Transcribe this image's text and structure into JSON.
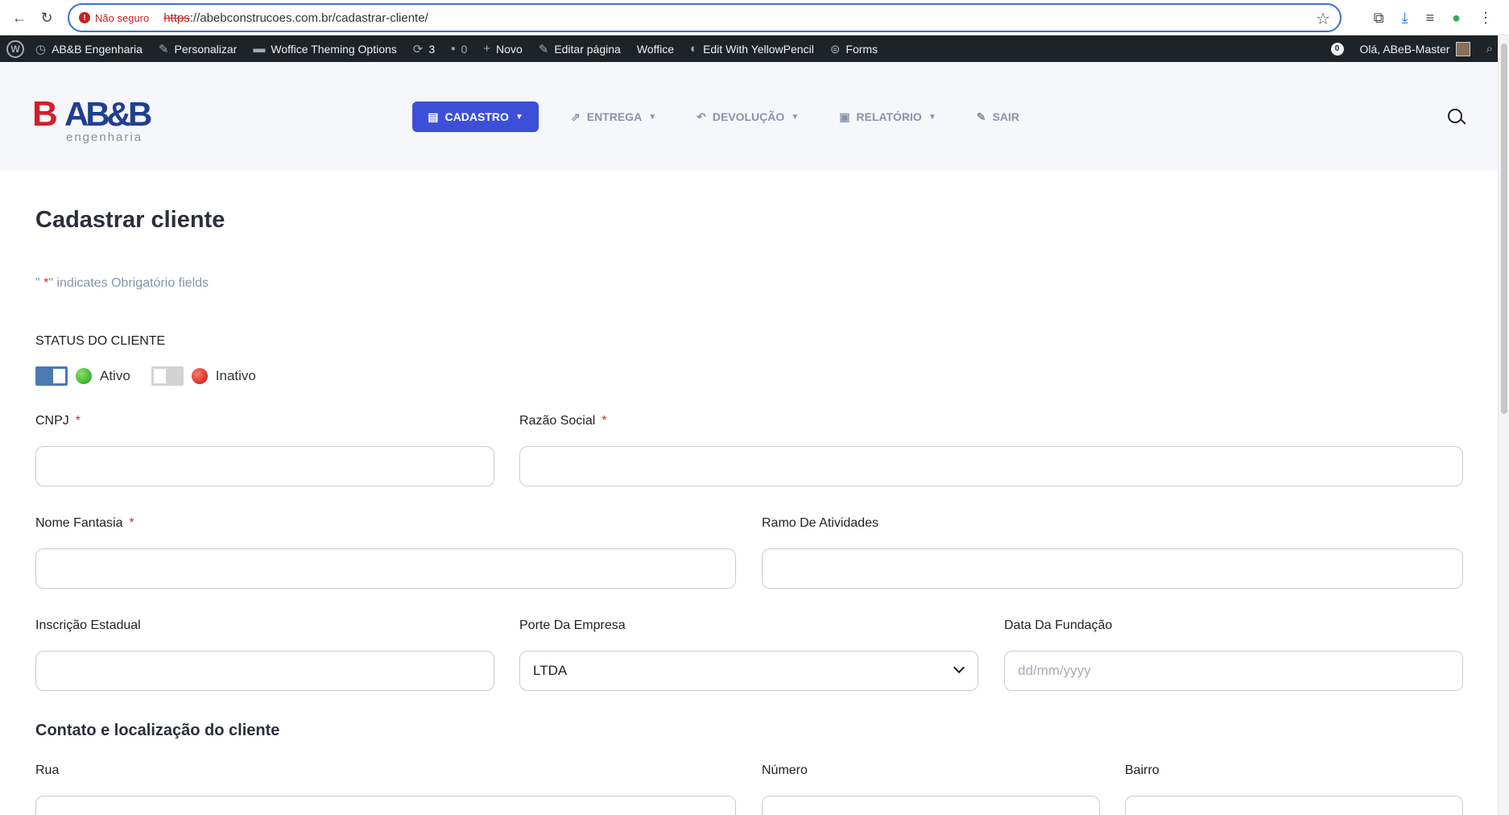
{
  "browser": {
    "not_secure": "Não seguro",
    "url_protocol": "https",
    "url_rest": "://abebconstrucoes.com.br/cadastrar-cliente/"
  },
  "adminbar": {
    "site": "AB&B Engenharia",
    "customize": "Personalizar",
    "theme_options": "Woffice Theming Options",
    "updates": "3",
    "comments": "0",
    "new": "Novo",
    "edit": "Editar página",
    "woffice": "Woffice",
    "yellowpencil": "Edit With YellowPencil",
    "forms": "Forms",
    "notif_count": "0",
    "greeting": "Olá, ABeB-Master"
  },
  "header": {
    "logo_mark": "B",
    "logo_text": "AB&B",
    "logo_sub": "engenharia",
    "menu": [
      {
        "label": "CADASTRO",
        "icon": "clipboard-icon",
        "active": true
      },
      {
        "label": "ENTREGA",
        "icon": "share-icon",
        "active": false
      },
      {
        "label": "DEVOLUÇÃO",
        "icon": "reply-all-icon",
        "active": false
      },
      {
        "label": "RELATÓRIO",
        "icon": "report-icon",
        "active": false
      },
      {
        "label": "SAIR",
        "icon": "edit-icon",
        "active": false
      }
    ]
  },
  "form": {
    "title": "Cadastrar cliente",
    "required_note_pre": "\" ",
    "required_note_star": "*",
    "required_note_post": "\" indicates Obrigatório fields",
    "status_label": "STATUS DO CLIENTE",
    "status_active": "Ativo",
    "status_inactive": "Inativo",
    "required_star": "*",
    "cnpj_label": "CNPJ",
    "razao_label": "Razão Social",
    "fantasia_label": "Nome Fantasia",
    "ramo_label": "Ramo De Atividades",
    "ie_label": "Inscrição Estadual",
    "porte_label": "Porte Da Empresa",
    "porte_value": "LTDA",
    "fundacao_label": "Data Da Fundação",
    "fundacao_placeholder": "dd/mm/yyyy",
    "section_contact": "Contato e localização do cliente",
    "rua_label": "Rua",
    "numero_label": "Número",
    "bairro_label": "Bairro"
  }
}
